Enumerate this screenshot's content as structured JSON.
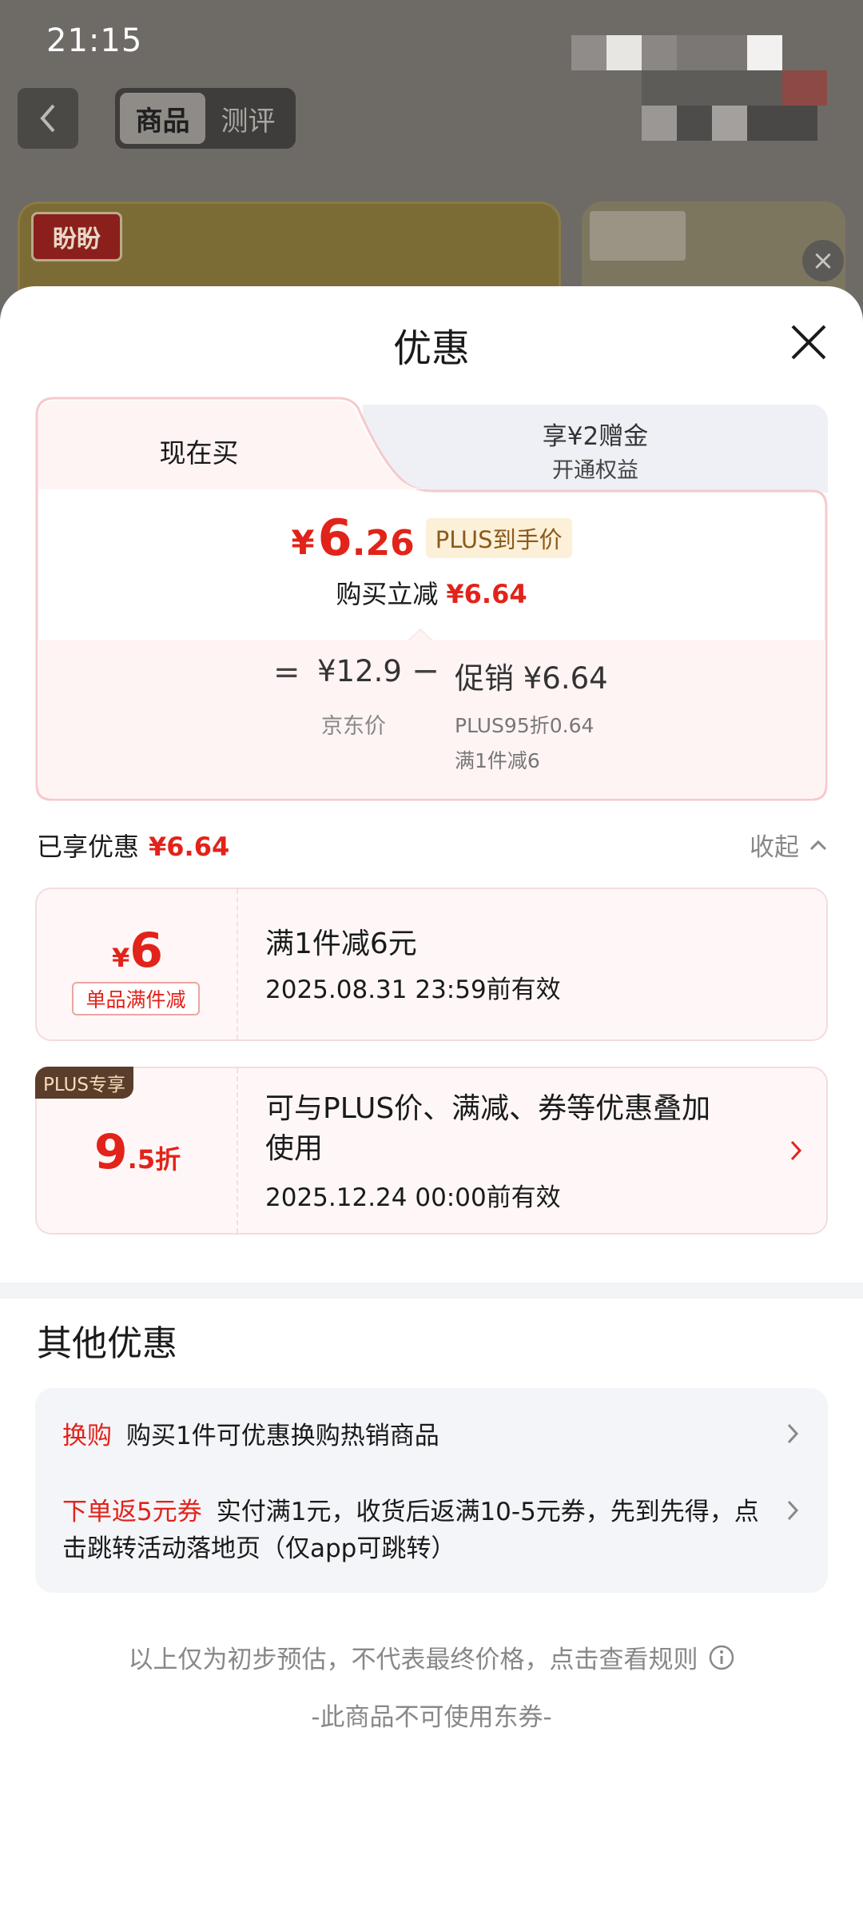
{
  "status_bar": {
    "time": "21:15"
  },
  "background_page": {
    "tabs": [
      "商品",
      "测评"
    ],
    "active_tab": "商品",
    "brand_logo_text": "盼盼"
  },
  "sheet": {
    "title": "优惠",
    "tabs": {
      "buy_now": "现在买",
      "plus_main": "享¥2赠金",
      "plus_sub": "开通权益"
    },
    "final_price": {
      "yen": "¥",
      "integer": "6",
      "decimal": ".26",
      "badge": "PLUS到手价"
    },
    "reduction": {
      "label": "购买立减",
      "value": "¥6.64"
    },
    "formula": {
      "equals": "=",
      "jd_price": "¥12.9",
      "minus": "−",
      "promo": "促销 ¥6.64",
      "jd_price_label": "京东价",
      "detail_1": "PLUS95折0.64",
      "detail_2": "满1件减6"
    },
    "enjoyed": {
      "label": "已享优惠",
      "value": "¥6.64",
      "collapse": "收起"
    },
    "coupons": [
      {
        "yen": "¥",
        "amount": "6",
        "tag": "单品满件减",
        "title": "满1件减6元",
        "expiry": "2025.08.31 23:59前有效"
      },
      {
        "corner": "PLUS专享",
        "amount_int": "9",
        "amount_dec": ".5折",
        "title_line1": "可与PLUS价、满减、券等优惠叠加",
        "title_line2": "使用",
        "expiry": "2025.12.24 00:00前有效"
      }
    ],
    "other": {
      "title": "其他优惠",
      "items": [
        {
          "label": "换购",
          "text": "购买1件可优惠换购热销商品"
        },
        {
          "label": "下单返5元券",
          "text": "实付满1元，收货后返满10-5元券，先到先得，点击跳转活动落地页（仅app可跳转）"
        }
      ]
    },
    "disclaimer": "以上仅为初步预估，不代表最终价格，点击查看规则",
    "no_coupon_note": "-此商品不可使用东券-"
  },
  "colors": {
    "accent_red": "#e2231a",
    "plus_gold": "#8b5a1b",
    "plus_dark": "#5b3d2b"
  }
}
